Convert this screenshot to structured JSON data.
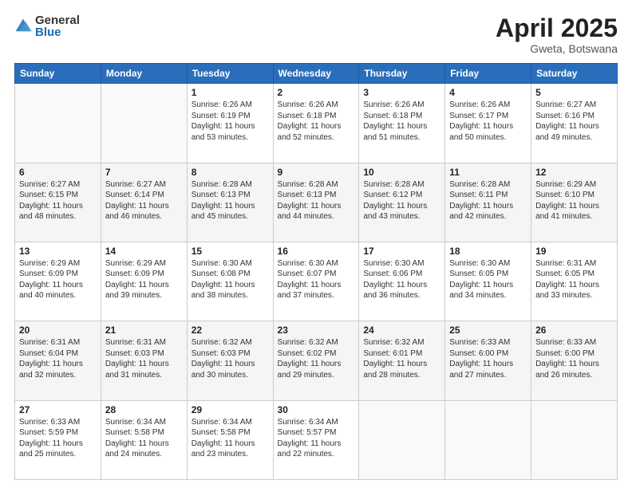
{
  "logo": {
    "general": "General",
    "blue": "Blue"
  },
  "title": {
    "month": "April 2025",
    "location": "Gweta, Botswana"
  },
  "weekdays": [
    "Sunday",
    "Monday",
    "Tuesday",
    "Wednesday",
    "Thursday",
    "Friday",
    "Saturday"
  ],
  "weeks": [
    [
      {
        "day": "",
        "sunrise": "",
        "sunset": "",
        "daylight": ""
      },
      {
        "day": "",
        "sunrise": "",
        "sunset": "",
        "daylight": ""
      },
      {
        "day": "1",
        "sunrise": "Sunrise: 6:26 AM",
        "sunset": "Sunset: 6:19 PM",
        "daylight": "Daylight: 11 hours and 53 minutes."
      },
      {
        "day": "2",
        "sunrise": "Sunrise: 6:26 AM",
        "sunset": "Sunset: 6:18 PM",
        "daylight": "Daylight: 11 hours and 52 minutes."
      },
      {
        "day": "3",
        "sunrise": "Sunrise: 6:26 AM",
        "sunset": "Sunset: 6:18 PM",
        "daylight": "Daylight: 11 hours and 51 minutes."
      },
      {
        "day": "4",
        "sunrise": "Sunrise: 6:26 AM",
        "sunset": "Sunset: 6:17 PM",
        "daylight": "Daylight: 11 hours and 50 minutes."
      },
      {
        "day": "5",
        "sunrise": "Sunrise: 6:27 AM",
        "sunset": "Sunset: 6:16 PM",
        "daylight": "Daylight: 11 hours and 49 minutes."
      }
    ],
    [
      {
        "day": "6",
        "sunrise": "Sunrise: 6:27 AM",
        "sunset": "Sunset: 6:15 PM",
        "daylight": "Daylight: 11 hours and 48 minutes."
      },
      {
        "day": "7",
        "sunrise": "Sunrise: 6:27 AM",
        "sunset": "Sunset: 6:14 PM",
        "daylight": "Daylight: 11 hours and 46 minutes."
      },
      {
        "day": "8",
        "sunrise": "Sunrise: 6:28 AM",
        "sunset": "Sunset: 6:13 PM",
        "daylight": "Daylight: 11 hours and 45 minutes."
      },
      {
        "day": "9",
        "sunrise": "Sunrise: 6:28 AM",
        "sunset": "Sunset: 6:13 PM",
        "daylight": "Daylight: 11 hours and 44 minutes."
      },
      {
        "day": "10",
        "sunrise": "Sunrise: 6:28 AM",
        "sunset": "Sunset: 6:12 PM",
        "daylight": "Daylight: 11 hours and 43 minutes."
      },
      {
        "day": "11",
        "sunrise": "Sunrise: 6:28 AM",
        "sunset": "Sunset: 6:11 PM",
        "daylight": "Daylight: 11 hours and 42 minutes."
      },
      {
        "day": "12",
        "sunrise": "Sunrise: 6:29 AM",
        "sunset": "Sunset: 6:10 PM",
        "daylight": "Daylight: 11 hours and 41 minutes."
      }
    ],
    [
      {
        "day": "13",
        "sunrise": "Sunrise: 6:29 AM",
        "sunset": "Sunset: 6:09 PM",
        "daylight": "Daylight: 11 hours and 40 minutes."
      },
      {
        "day": "14",
        "sunrise": "Sunrise: 6:29 AM",
        "sunset": "Sunset: 6:09 PM",
        "daylight": "Daylight: 11 hours and 39 minutes."
      },
      {
        "day": "15",
        "sunrise": "Sunrise: 6:30 AM",
        "sunset": "Sunset: 6:08 PM",
        "daylight": "Daylight: 11 hours and 38 minutes."
      },
      {
        "day": "16",
        "sunrise": "Sunrise: 6:30 AM",
        "sunset": "Sunset: 6:07 PM",
        "daylight": "Daylight: 11 hours and 37 minutes."
      },
      {
        "day": "17",
        "sunrise": "Sunrise: 6:30 AM",
        "sunset": "Sunset: 6:06 PM",
        "daylight": "Daylight: 11 hours and 36 minutes."
      },
      {
        "day": "18",
        "sunrise": "Sunrise: 6:30 AM",
        "sunset": "Sunset: 6:05 PM",
        "daylight": "Daylight: 11 hours and 34 minutes."
      },
      {
        "day": "19",
        "sunrise": "Sunrise: 6:31 AM",
        "sunset": "Sunset: 6:05 PM",
        "daylight": "Daylight: 11 hours and 33 minutes."
      }
    ],
    [
      {
        "day": "20",
        "sunrise": "Sunrise: 6:31 AM",
        "sunset": "Sunset: 6:04 PM",
        "daylight": "Daylight: 11 hours and 32 minutes."
      },
      {
        "day": "21",
        "sunrise": "Sunrise: 6:31 AM",
        "sunset": "Sunset: 6:03 PM",
        "daylight": "Daylight: 11 hours and 31 minutes."
      },
      {
        "day": "22",
        "sunrise": "Sunrise: 6:32 AM",
        "sunset": "Sunset: 6:03 PM",
        "daylight": "Daylight: 11 hours and 30 minutes."
      },
      {
        "day": "23",
        "sunrise": "Sunrise: 6:32 AM",
        "sunset": "Sunset: 6:02 PM",
        "daylight": "Daylight: 11 hours and 29 minutes."
      },
      {
        "day": "24",
        "sunrise": "Sunrise: 6:32 AM",
        "sunset": "Sunset: 6:01 PM",
        "daylight": "Daylight: 11 hours and 28 minutes."
      },
      {
        "day": "25",
        "sunrise": "Sunrise: 6:33 AM",
        "sunset": "Sunset: 6:00 PM",
        "daylight": "Daylight: 11 hours and 27 minutes."
      },
      {
        "day": "26",
        "sunrise": "Sunrise: 6:33 AM",
        "sunset": "Sunset: 6:00 PM",
        "daylight": "Daylight: 11 hours and 26 minutes."
      }
    ],
    [
      {
        "day": "27",
        "sunrise": "Sunrise: 6:33 AM",
        "sunset": "Sunset: 5:59 PM",
        "daylight": "Daylight: 11 hours and 25 minutes."
      },
      {
        "day": "28",
        "sunrise": "Sunrise: 6:34 AM",
        "sunset": "Sunset: 5:58 PM",
        "daylight": "Daylight: 11 hours and 24 minutes."
      },
      {
        "day": "29",
        "sunrise": "Sunrise: 6:34 AM",
        "sunset": "Sunset: 5:58 PM",
        "daylight": "Daylight: 11 hours and 23 minutes."
      },
      {
        "day": "30",
        "sunrise": "Sunrise: 6:34 AM",
        "sunset": "Sunset: 5:57 PM",
        "daylight": "Daylight: 11 hours and 22 minutes."
      },
      {
        "day": "",
        "sunrise": "",
        "sunset": "",
        "daylight": ""
      },
      {
        "day": "",
        "sunrise": "",
        "sunset": "",
        "daylight": ""
      },
      {
        "day": "",
        "sunrise": "",
        "sunset": "",
        "daylight": ""
      }
    ]
  ]
}
